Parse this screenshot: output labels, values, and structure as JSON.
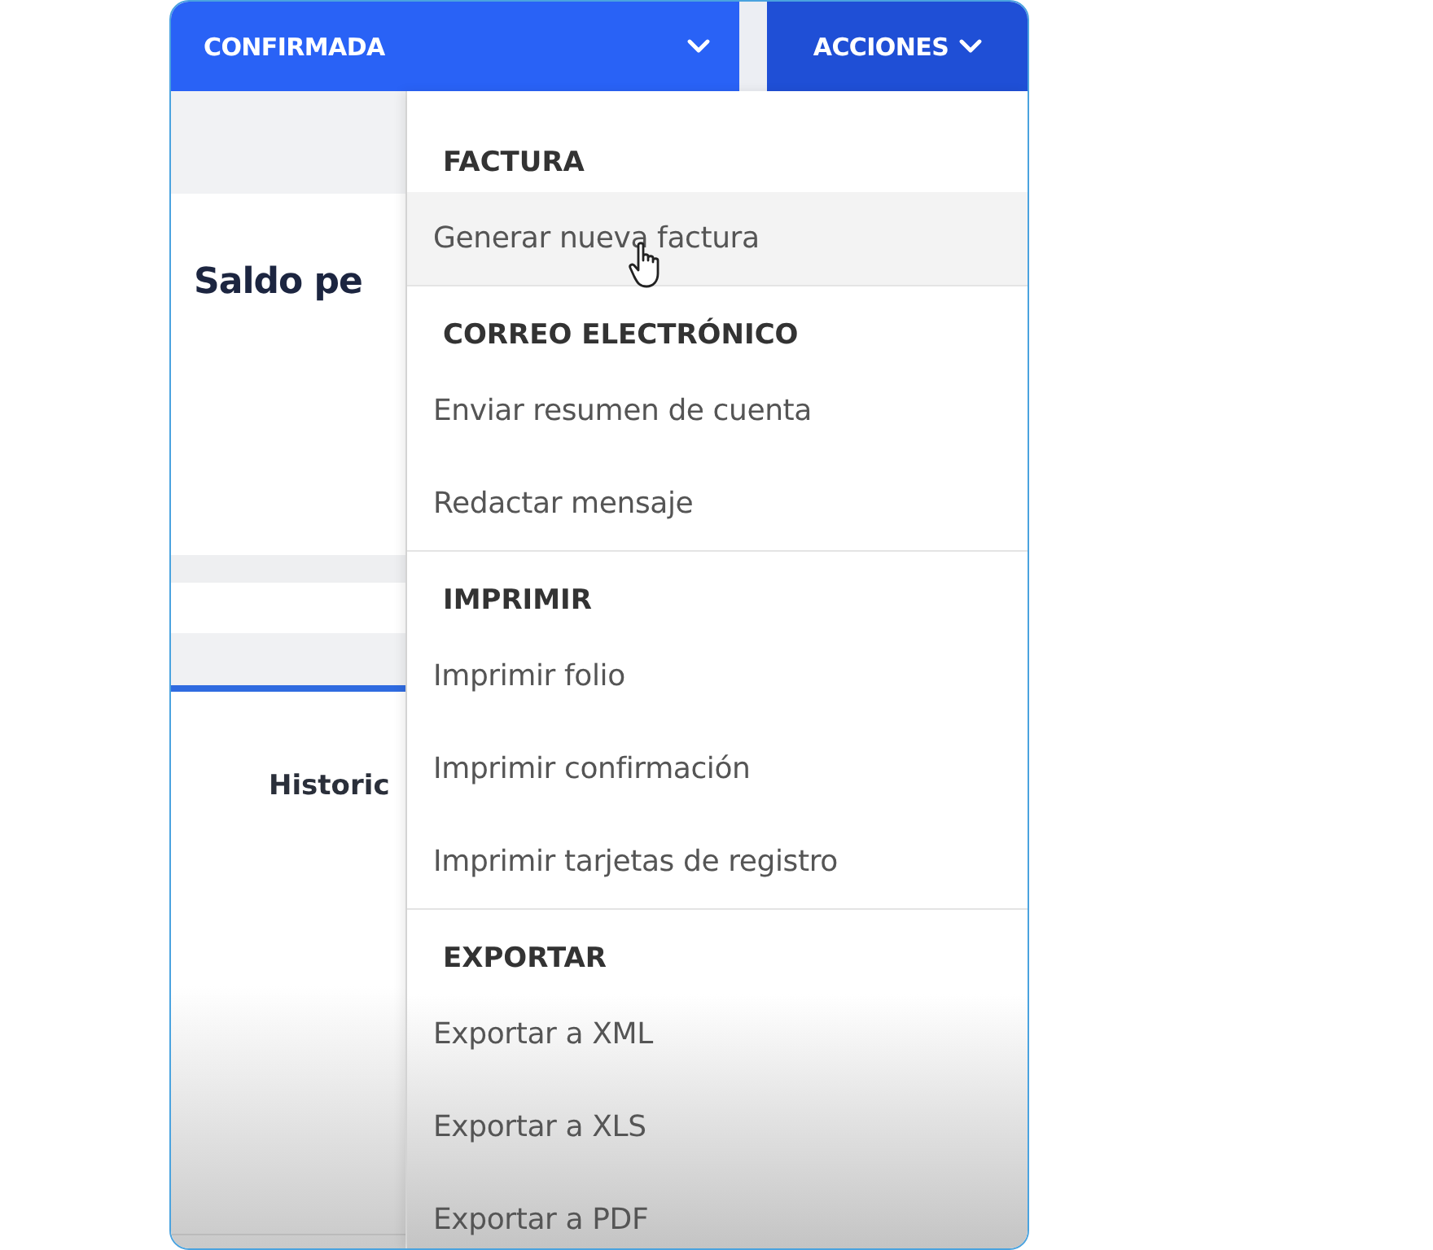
{
  "status_button": {
    "label": "CONFIRMADA"
  },
  "actions_button": {
    "label": "ACCIONES",
    "expanded": true
  },
  "background": {
    "heading": "Saldo pe",
    "section_title": "Historic"
  },
  "menu": {
    "sections": [
      {
        "title": "FACTURA",
        "items": [
          {
            "label": "Generar nueva factura",
            "hovered": true
          }
        ]
      },
      {
        "title": "CORREO ELECTRÓNICO",
        "items": [
          {
            "label": "Enviar resumen de cuenta",
            "hovered": false
          },
          {
            "label": "Redactar mensaje",
            "hovered": false
          }
        ]
      },
      {
        "title": "IMPRIMIR",
        "items": [
          {
            "label": "Imprimir folio",
            "hovered": false
          },
          {
            "label": "Imprimir confirmación",
            "hovered": false
          },
          {
            "label": "Imprimir tarjetas de registro",
            "hovered": false
          }
        ]
      },
      {
        "title": "EXPORTAR",
        "items": [
          {
            "label": "Exportar a XML",
            "hovered": false
          },
          {
            "label": "Exportar a XLS",
            "hovered": false
          },
          {
            "label": "Exportar a PDF",
            "hovered": false
          }
        ]
      }
    ]
  }
}
